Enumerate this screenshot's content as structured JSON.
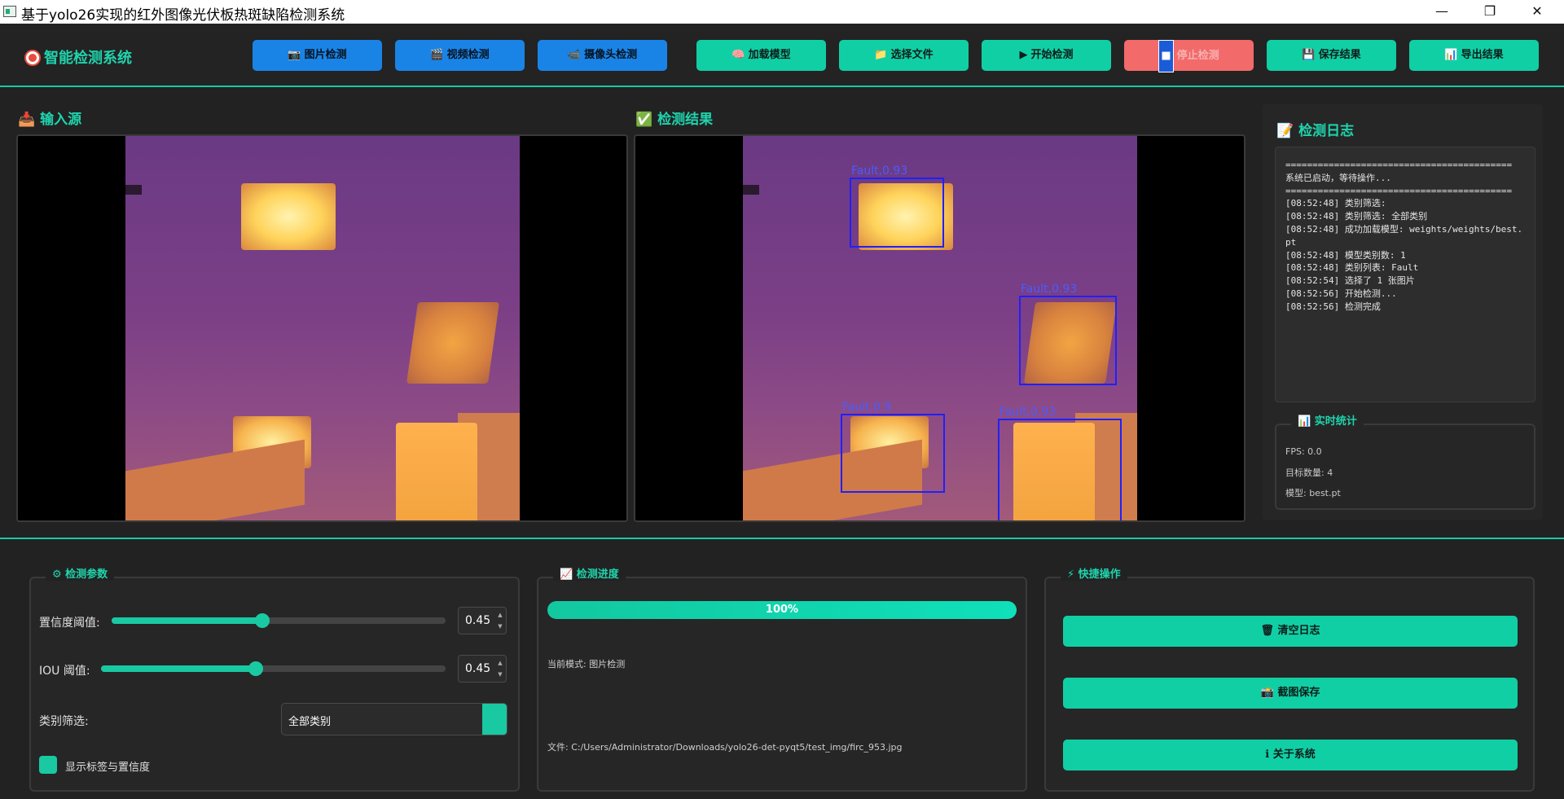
{
  "window": {
    "title": "基于yolo26实现的红外图像光伏板热斑缺陷检测系统",
    "controls": {
      "minimize": "—",
      "maximize": "❐",
      "close": "✕"
    }
  },
  "toolbar": {
    "brand": "智能检测系统",
    "buttons": [
      {
        "icon": "📷",
        "label": "图片检测"
      },
      {
        "icon": "🎬",
        "label": "视频检测"
      },
      {
        "icon": "📹",
        "label": "摄像头检测"
      },
      {
        "icon": "🧠",
        "label": "加载模型"
      },
      {
        "icon": "📁",
        "label": "选择文件"
      },
      {
        "icon": "▶",
        "label": "开始检测"
      },
      {
        "icon": "■",
        "label": "停止检测"
      },
      {
        "icon": "💾",
        "label": "保存结果"
      },
      {
        "icon": "📊",
        "label": "导出结果"
      }
    ]
  },
  "input_panel": {
    "icon": "📥",
    "title": "输入源"
  },
  "result_panel": {
    "icon": "✅",
    "title": "检测结果",
    "detections": [
      {
        "label": "Fault,0.93"
      },
      {
        "label": "Fault,0.93"
      },
      {
        "label": "Fault,0.9"
      },
      {
        "label": "Fault,0.93"
      }
    ]
  },
  "log": {
    "icon": "📝",
    "title": "检测日志",
    "text": "==========================================\n系统已启动，等待操作...\n==========================================\n[08:52:48] 类别筛选:\n[08:52:48] 类别筛选: 全部类别\n[08:52:48] 成功加载模型: weights/weights/best.pt\n[08:52:48] 模型类别数: 1\n[08:52:48] 类别列表: Fault\n[08:52:54] 选择了 1 张图片\n[08:52:56] 开始检测...\n[08:52:56] 检测完成"
  },
  "stats": {
    "title": "📊 实时统计",
    "fps": "FPS: 0.0",
    "targets": "目标数量: 4",
    "model": "模型: best.pt"
  },
  "params": {
    "title": "⚙ 检测参数",
    "confidence_label": "置信度阈值:",
    "confidence_value": "0.45",
    "confidence_level": 0.45,
    "iou_label": "IOU 阈值:",
    "iou_value": "0.45",
    "iou_level": 0.45,
    "class_label": "类别筛选:",
    "class_value": "全部类别",
    "show_labels": "显示标签与置信度"
  },
  "progress": {
    "title": "📈 检测进度",
    "percent_text": "100%",
    "percent": 100,
    "mode": "当前模式: 图片检测",
    "file": "文件: C:/Users/Administrator/Downloads/yolo26-det-pyqt5/test_img/firc_953.jpg"
  },
  "quick": {
    "title": "⚡ 快捷操作",
    "buttons": [
      "🗑 清空日志",
      "📸 截图保存",
      "ℹ 关于系统"
    ]
  },
  "colors": {
    "accent": "#19c9a2",
    "blue": "#1a84e6",
    "stop": "#f36a6a",
    "bbox": "#2020ff"
  }
}
